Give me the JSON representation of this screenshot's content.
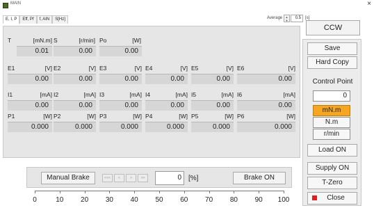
{
  "window": {
    "title": "MAIN"
  },
  "tabs": [
    {
      "label": "E, I, P"
    },
    {
      "label": "Eff, Pf"
    },
    {
      "label": "f, AIN"
    },
    {
      "label": "S[Hz]"
    }
  ],
  "average": {
    "label": "Average",
    "value": "0.5",
    "unit": "[s]"
  },
  "direction_button": "CCW",
  "measurements": {
    "row0": [
      {
        "name": "T",
        "unit": "[mN.m]",
        "value": "0.01"
      },
      {
        "name": "S",
        "unit": "[r/min]",
        "value": "0.00"
      },
      {
        "name": "Po",
        "unit": "[W]",
        "value": "0.00"
      }
    ],
    "voltage": [
      {
        "name": "E1",
        "unit": "[V]",
        "value": "0.00"
      },
      {
        "name": "E2",
        "unit": "[V]",
        "value": "0.00"
      },
      {
        "name": "E3",
        "unit": "[V]",
        "value": "0.00"
      },
      {
        "name": "E4",
        "unit": "[V]",
        "value": "0.00"
      },
      {
        "name": "E5",
        "unit": "[V]",
        "value": "0.00"
      },
      {
        "name": "E6",
        "unit": "[V]",
        "value": "0.00"
      }
    ],
    "current": [
      {
        "name": "I1",
        "unit": "[mA]",
        "value": "0.00"
      },
      {
        "name": "I2",
        "unit": "[mA]",
        "value": "0.00"
      },
      {
        "name": "I3",
        "unit": "[mA]",
        "value": "0.00"
      },
      {
        "name": "I4",
        "unit": "[mA]",
        "value": "0.00"
      },
      {
        "name": "I5",
        "unit": "[mA]",
        "value": "0.00"
      },
      {
        "name": "I6",
        "unit": "[mA]",
        "value": "0.00"
      }
    ],
    "power": [
      {
        "name": "P1",
        "unit": "[W]",
        "value": "0.000"
      },
      {
        "name": "P2",
        "unit": "[W]",
        "value": "0.000"
      },
      {
        "name": "P3",
        "unit": "[W]",
        "value": "0.000"
      },
      {
        "name": "P4",
        "unit": "[W]",
        "value": "0.000"
      },
      {
        "name": "P5",
        "unit": "[W]",
        "value": "0.000"
      },
      {
        "name": "P6",
        "unit": "[W]",
        "value": "0.000"
      }
    ]
  },
  "brake": {
    "manual_label": "Manual Brake",
    "step_buttons": [
      "<<<",
      "<",
      ">",
      ">>"
    ],
    "value": "0",
    "unit": "[%]",
    "on_label": "Brake ON"
  },
  "scale": {
    "ticks": [
      "0",
      "10",
      "20",
      "30",
      "40",
      "50",
      "60",
      "70",
      "80",
      "90",
      "100"
    ]
  },
  "side": {
    "save": "Save",
    "hard_copy": "Hard Copy",
    "control_point_label": "Control Point",
    "control_point_value": "0",
    "units": [
      "mN.m",
      "N.m",
      "r/min"
    ],
    "active_unit": "mN.m",
    "load_on": "Load ON",
    "supply_on": "Supply ON",
    "t_zero": "T-Zero",
    "close": "Close"
  },
  "colors": {
    "active_unit": "#f5a623",
    "close_icon": "#e01e1e",
    "panel": "#e6e6e6"
  }
}
